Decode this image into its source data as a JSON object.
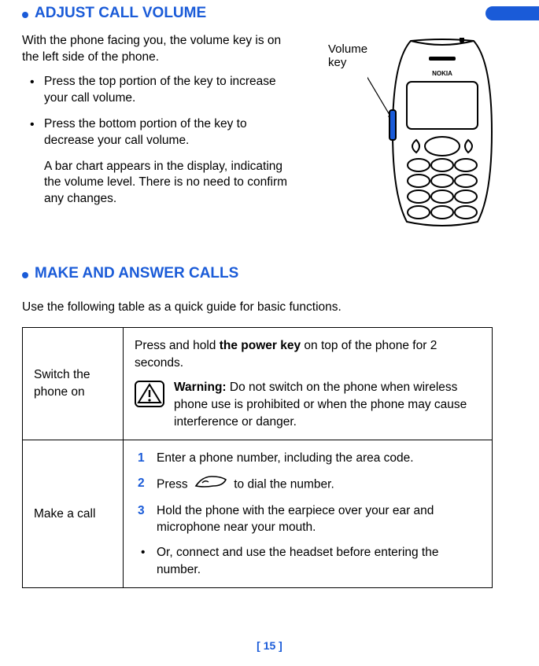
{
  "header_tab_color": "#1a5bd8",
  "section1": {
    "title": "ADJUST CALL VOLUME",
    "intro": "With the phone facing you, the volume key is on the left side of the phone.",
    "bullets": [
      "Press the top portion of the key to increase your call volume.",
      "Press the bottom portion of the key to decrease your call volume."
    ],
    "after": "A bar chart appears in the display, indicating the volume level. There is no need to confirm any changes.",
    "fig_label_line1": "Volume",
    "fig_label_line2": "key",
    "phone_brand": "NOKIA"
  },
  "section2": {
    "title": "MAKE AND ANSWER CALLS",
    "intro": "Use the following table as a quick guide for basic functions.",
    "rows": [
      {
        "label": "Switch the phone on",
        "main_pre": "Press and hold ",
        "main_bold": "the power key",
        "main_post": " on top of the phone for 2 seconds.",
        "warning_label": "Warning:",
        "warning_text": " Do not switch on the phone when wireless phone use is prohibited or when the phone may cause interference or danger."
      },
      {
        "label": "Make a call",
        "steps": [
          "Enter a phone number, including the area code.",
          {
            "pre": "Press ",
            "post": " to dial the number."
          },
          "Hold the phone with the earpiece over your ear and microphone near your mouth."
        ],
        "sub": "Or, connect and use the headset before entering the number."
      }
    ]
  },
  "footer": "[ 15 ]"
}
